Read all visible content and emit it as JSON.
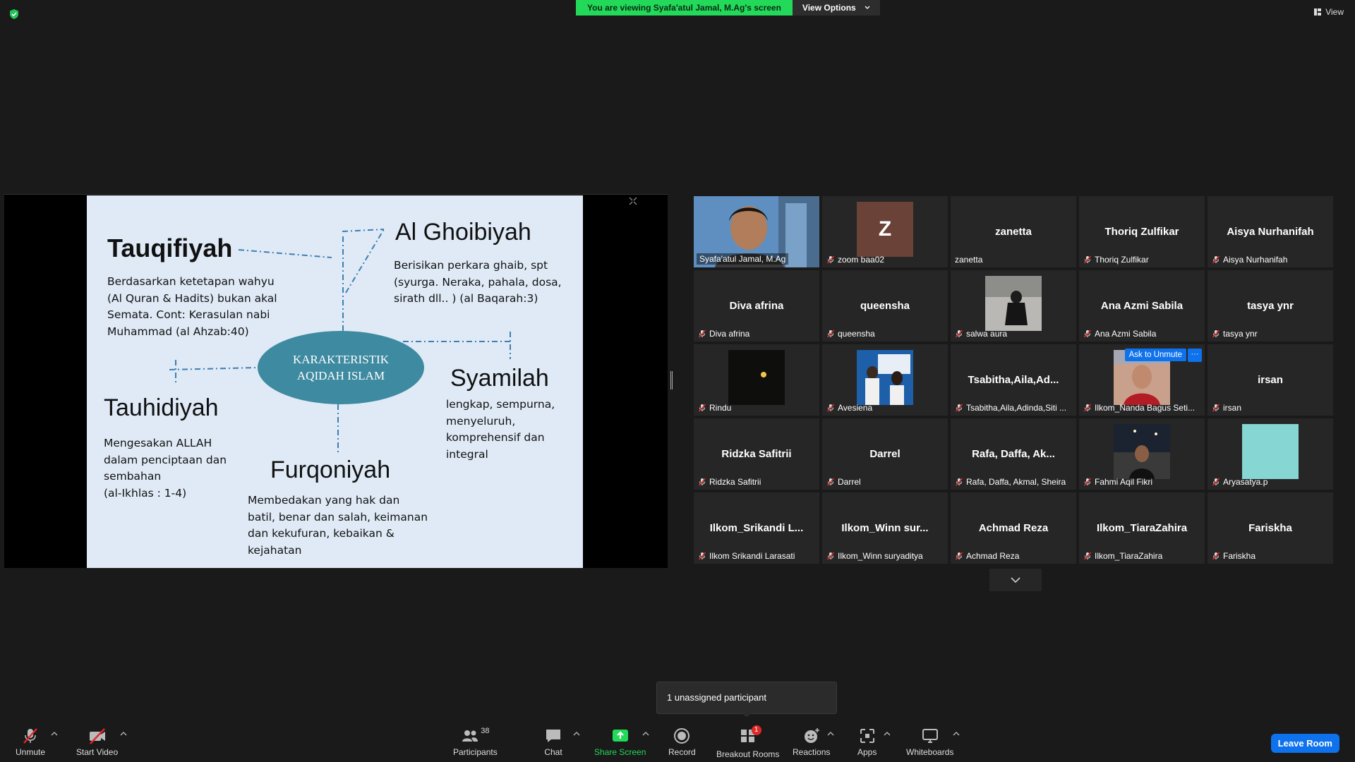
{
  "banner": {
    "viewing_text": "You are viewing Syafa'atul Jamal, M.Ag's screen",
    "view_options_label": "View Options"
  },
  "view_button_label": "View",
  "slide": {
    "center": "KARAKTERISTIK AQIDAH ISLAM",
    "center_line1": "KARAKTERISTIK",
    "center_line2": "AQIDAH ISLAM",
    "tauqifiyah_title": "Tauqifiyah",
    "tauqifiyah_text": [
      "Berdasarkan ketetapan wahyu",
      "(Al Quran & Hadits) bukan akal",
      "Semata. Cont: Kerasulan nabi",
      "Muhammad  (al Ahzab:40)"
    ],
    "ghoibiyah_title": "Al Ghoibiyah",
    "ghoibiyah_text": [
      "Berisikan perkara ghaib, spt",
      "(syurga. Neraka, pahala, dosa,",
      "sirath dll.. ) (al Baqarah:3)"
    ],
    "tauhidiyah_title": "Tauhidiyah",
    "tauhidiyah_text": [
      "Mengesakan ALLAH",
      "dalam penciptaan dan",
      "sembahan",
      "(al-Ikhlas : 1-4)"
    ],
    "syamilah_title": "Syamilah",
    "syamilah_text": [
      "lengkap, sempurna,",
      "menyeluruh,",
      "komprehensif dan",
      "integral"
    ],
    "furqoniyah_title": "Furqoniyah",
    "furqoniyah_text": [
      "Membedakan yang hak dan",
      "batil, benar dan salah, keimanan",
      "dan kekufuran, kebaikan &",
      "kejahatan"
    ]
  },
  "participants": [
    {
      "center": "",
      "label": "Syafa'atul Jamal, M.Ag",
      "muted": false,
      "active": true,
      "photo": "speaker"
    },
    {
      "center": "Z",
      "label": "zoom baa02",
      "muted": true,
      "avatar": "#6b4238"
    },
    {
      "center": "zanetta",
      "label": "zanetta",
      "muted": false
    },
    {
      "center": "Thoriq Zulfikar",
      "label": "Thoriq Zulfikar",
      "muted": true
    },
    {
      "center": "Aisya Nurhanifah",
      "label": "Aisya Nurhanifah",
      "muted": true
    },
    {
      "center": "Diva afrina",
      "label": "Diva afrina",
      "muted": true
    },
    {
      "center": "queensha",
      "label": "queensha",
      "muted": true
    },
    {
      "center": "",
      "label": "salwa aura",
      "muted": true,
      "photo": "salwa"
    },
    {
      "center": "Ana Azmi Sabila",
      "label": "Ana Azmi Sabila",
      "muted": true
    },
    {
      "center": "tasya ynr",
      "label": "tasya ynr",
      "muted": true
    },
    {
      "center": "",
      "label": "Rindu",
      "muted": true,
      "photo": "rindu"
    },
    {
      "center": "",
      "label": "Avesiena",
      "muted": true,
      "photo": "avesiena"
    },
    {
      "center": "Tsabitha,Aila,Ad...",
      "label": "Tsabitha,Aila,Adinda,Siti ...",
      "muted": true
    },
    {
      "center": "",
      "label": "Ilkom_Nanda Bagus Seti...",
      "muted": true,
      "photo": "nanda",
      "ask": "Ask to Unmute"
    },
    {
      "center": "irsan",
      "label": "irsan",
      "muted": true
    },
    {
      "center": "Ridzka Safitrii",
      "label": "Ridzka Safitrii",
      "muted": true
    },
    {
      "center": "Darrel",
      "label": "Darrel",
      "muted": true
    },
    {
      "center": "Rafa, Daffa, Ak...",
      "label": "Rafa, Daffa, Akmal, Sheira",
      "muted": true
    },
    {
      "center": "",
      "label": "Fahmi Aqil Fikri",
      "muted": true,
      "photo": "fahmi"
    },
    {
      "center": "",
      "label": "Aryasatya.p",
      "muted": true,
      "avatar2": "#86d6d3"
    },
    {
      "center": "Ilkom_Srikandi  L...",
      "label": "Ilkom Srikandi Larasati",
      "muted": true
    },
    {
      "center": "Ilkom_Winn  sur...",
      "label": "Ilkom_Winn suryaditya",
      "muted": true
    },
    {
      "center": "Achmad Reza",
      "label": "Achmad Reza",
      "muted": true
    },
    {
      "center": "Ilkom_TiaraZahira",
      "label": "Ilkom_TiaraZahira",
      "muted": true
    },
    {
      "center": "Fariskha",
      "label": "Fariskha",
      "muted": true
    }
  ],
  "tooltip": "1 unassigned participant",
  "toolbar": {
    "unmute": "Unmute",
    "start_video": "Start Video",
    "participants": "Participants",
    "participants_count": "38",
    "chat": "Chat",
    "share_screen": "Share Screen",
    "record": "Record",
    "breakout_rooms": "Breakout Rooms",
    "breakout_badge": "1",
    "reactions": "Reactions",
    "apps": "Apps",
    "whiteboards": "Whiteboards",
    "leave": "Leave Room"
  },
  "colors": {
    "share_green": "#23d959",
    "accent_blue": "#0e72ed",
    "mute_red": "#e02828",
    "active_border": "#e3e65a"
  }
}
